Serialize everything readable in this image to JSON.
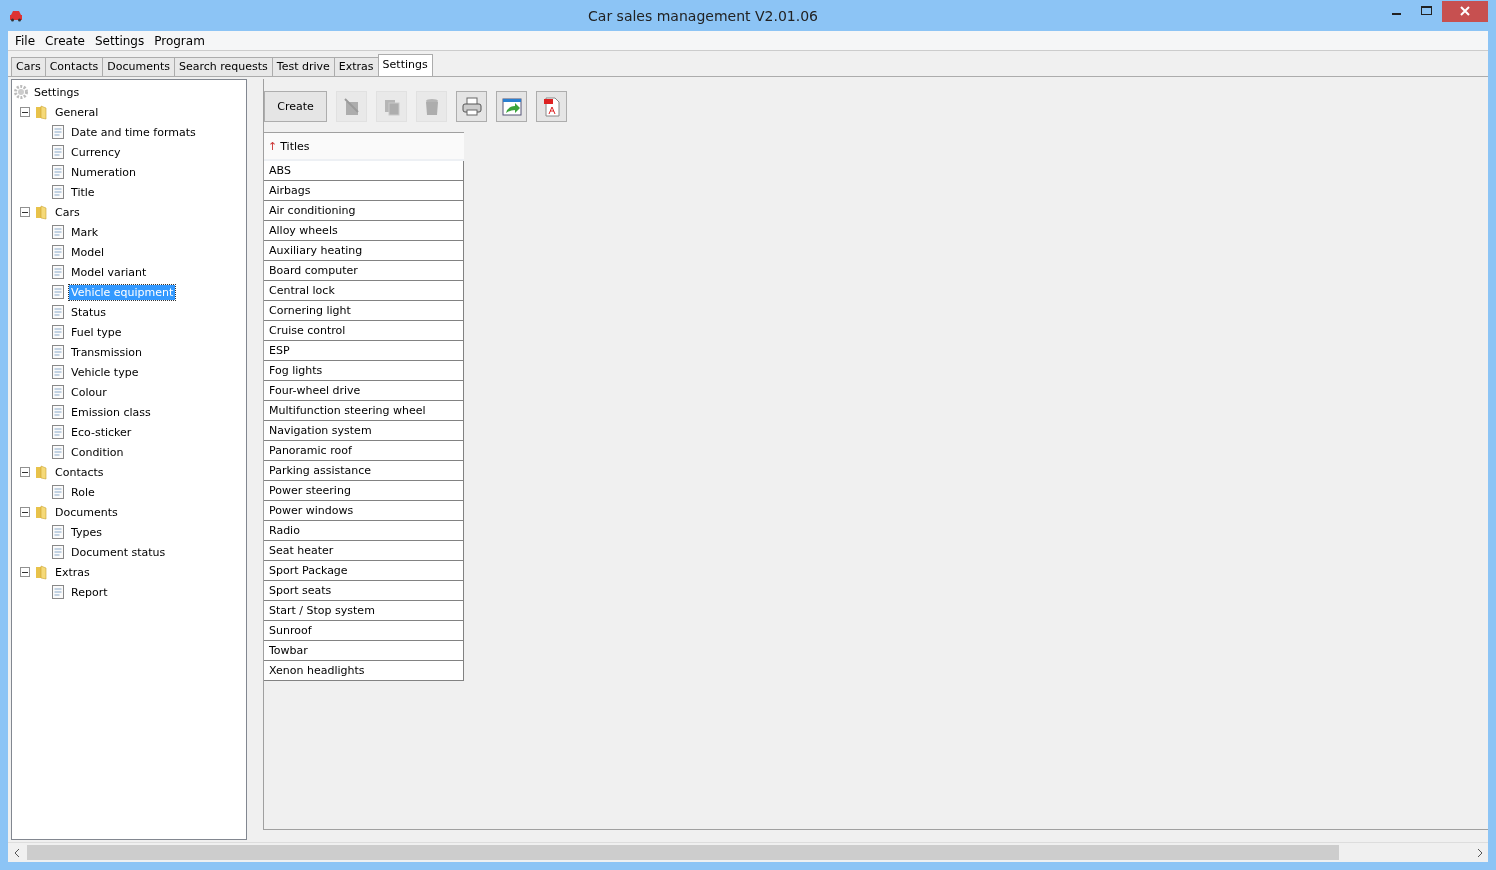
{
  "window": {
    "title": "Car sales management V2.01.06"
  },
  "menu": [
    "File",
    "Create",
    "Settings",
    "Program"
  ],
  "tabs": [
    {
      "label": "Cars",
      "selected": false
    },
    {
      "label": "Contacts",
      "selected": false
    },
    {
      "label": "Documents",
      "selected": false
    },
    {
      "label": "Search requests",
      "selected": false
    },
    {
      "label": "Test drive",
      "selected": false
    },
    {
      "label": "Extras",
      "selected": false
    },
    {
      "label": "Settings",
      "selected": true
    }
  ],
  "tree": {
    "label": "Settings",
    "children": [
      {
        "label": "General",
        "expanded": true,
        "children": [
          {
            "label": "Date and time formats",
            "selected": false
          },
          {
            "label": "Currency",
            "selected": false
          },
          {
            "label": "Numeration",
            "selected": false
          },
          {
            "label": "Title",
            "selected": false
          }
        ]
      },
      {
        "label": "Cars",
        "expanded": true,
        "children": [
          {
            "label": "Mark",
            "selected": false
          },
          {
            "label": "Model",
            "selected": false
          },
          {
            "label": "Model variant",
            "selected": false
          },
          {
            "label": "Vehicle equipment",
            "selected": true
          },
          {
            "label": "Status",
            "selected": false
          },
          {
            "label": "Fuel type",
            "selected": false
          },
          {
            "label": "Transmission",
            "selected": false
          },
          {
            "label": "Vehicle type",
            "selected": false
          },
          {
            "label": "Colour",
            "selected": false
          },
          {
            "label": "Emission class",
            "selected": false
          },
          {
            "label": "Eco-sticker",
            "selected": false
          },
          {
            "label": "Condition",
            "selected": false
          }
        ]
      },
      {
        "label": "Contacts",
        "expanded": true,
        "children": [
          {
            "label": "Role",
            "selected": false
          }
        ]
      },
      {
        "label": "Documents",
        "expanded": true,
        "children": [
          {
            "label": "Types",
            "selected": false
          },
          {
            "label": "Document status",
            "selected": false
          }
        ]
      },
      {
        "label": "Extras",
        "expanded": true,
        "children": [
          {
            "label": "Report",
            "selected": false
          }
        ]
      }
    ]
  },
  "toolbar": [
    {
      "kind": "text",
      "label": "Create",
      "disabled": false
    },
    {
      "kind": "icon",
      "disabled": true
    },
    {
      "kind": "icon",
      "disabled": true
    },
    {
      "kind": "icon",
      "disabled": true
    },
    {
      "kind": "icon",
      "disabled": false
    },
    {
      "kind": "icon",
      "disabled": false
    },
    {
      "kind": "icon",
      "disabled": false
    }
  ],
  "table": {
    "sort_mark": "↑",
    "column": "Titles",
    "rows": [
      "ABS",
      "Airbags",
      "Air conditioning",
      "Alloy wheels",
      "Auxiliary heating",
      "Board computer",
      "Central lock",
      "Cornering light",
      "Cruise control",
      "ESP",
      "Fog lights",
      "Four-wheel drive",
      "Multifunction steering wheel",
      "Navigation system",
      "Panoramic roof",
      "Parking assistance",
      "Power steering",
      "Power windows",
      "Radio",
      "Seat heater",
      "Sport Package",
      "Sport seats",
      "Start / Stop system",
      "Sunroof",
      "Towbar",
      "Xenon headlights"
    ]
  }
}
